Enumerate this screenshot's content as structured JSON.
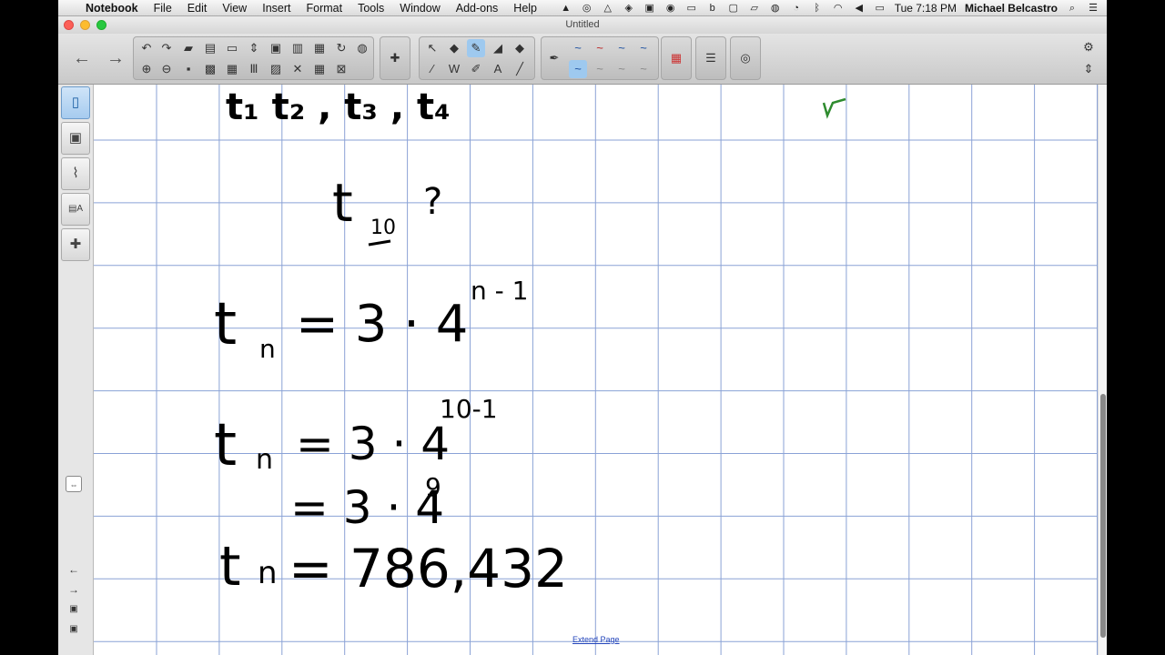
{
  "menubar": {
    "app_name": "Notebook",
    "menus": [
      "File",
      "Edit",
      "View",
      "Insert",
      "Format",
      "Tools",
      "Window",
      "Add-ons",
      "Help"
    ],
    "clock": "Tue 7:18 PM",
    "user": "Michael Belcastro"
  },
  "window": {
    "title": "Untitled"
  },
  "page": {
    "extend_link": "Extend Page",
    "lines": [
      {
        "main": "t₁   t₂ ,  t₃ ,  t₄"
      },
      {
        "main": "t",
        "sub": "10",
        "tail": "?"
      },
      {
        "main": "t",
        "sub": "n",
        "tail": "=  3 · 4",
        "sup": "n - 1"
      },
      {
        "main": "t",
        "sub": "n",
        "tail": "= 3 · 4",
        "sup": "10-1"
      },
      {
        "tail": "= 3 · 4",
        "sup": "9"
      },
      {
        "main": "t",
        "sub": "n",
        "tail": "= 786,432"
      }
    ]
  },
  "colors": {
    "grid": "#8aa2d6",
    "ink": "#000000",
    "green_ink": "#2e8b2e"
  }
}
